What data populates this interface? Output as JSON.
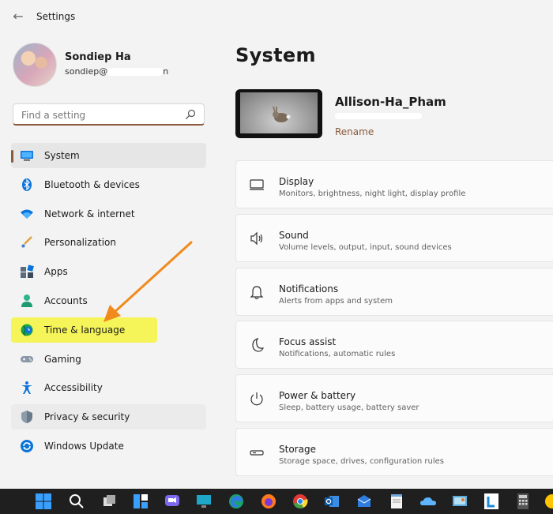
{
  "titlebar": {
    "title": "Settings",
    "back_glyph": "←"
  },
  "profile": {
    "name": "Sondiep Ha",
    "email_visible": "sondiep@",
    "email_tail": "n"
  },
  "search": {
    "placeholder": "Find a setting"
  },
  "sidebar": {
    "items": [
      {
        "label": "System",
        "icon": "system-icon"
      },
      {
        "label": "Bluetooth & devices",
        "icon": "bluetooth-icon"
      },
      {
        "label": "Network & internet",
        "icon": "wifi-icon"
      },
      {
        "label": "Personalization",
        "icon": "brush-icon"
      },
      {
        "label": "Apps",
        "icon": "apps-icon"
      },
      {
        "label": "Accounts",
        "icon": "person-icon"
      },
      {
        "label": "Time & language",
        "icon": "globe-clock-icon"
      },
      {
        "label": "Gaming",
        "icon": "gamepad-icon"
      },
      {
        "label": "Accessibility",
        "icon": "accessibility-icon"
      },
      {
        "label": "Privacy & security",
        "icon": "shield-icon"
      },
      {
        "label": "Windows Update",
        "icon": "update-icon"
      }
    ]
  },
  "main": {
    "title": "System",
    "device": {
      "name": "Allison-Ha_Pham",
      "rename": "Rename"
    },
    "cards": [
      {
        "title": "Display",
        "desc": "Monitors, brightness, night light, display profile",
        "icon": "monitor-icon"
      },
      {
        "title": "Sound",
        "desc": "Volume levels, output, input, sound devices",
        "icon": "speaker-icon"
      },
      {
        "title": "Notifications",
        "desc": "Alerts from apps and system",
        "icon": "bell-icon"
      },
      {
        "title": "Focus assist",
        "desc": "Notifications, automatic rules",
        "icon": "moon-icon"
      },
      {
        "title": "Power & battery",
        "desc": "Sleep, battery usage, battery saver",
        "icon": "power-icon"
      },
      {
        "title": "Storage",
        "desc": "Storage space, drives, configuration rules",
        "icon": "drive-icon"
      }
    ]
  },
  "colors": {
    "accent": "#8a5a3c",
    "highlight": "#f5f55a",
    "arrow": "#f08a1c",
    "taskbar": "#1f1f1f"
  }
}
